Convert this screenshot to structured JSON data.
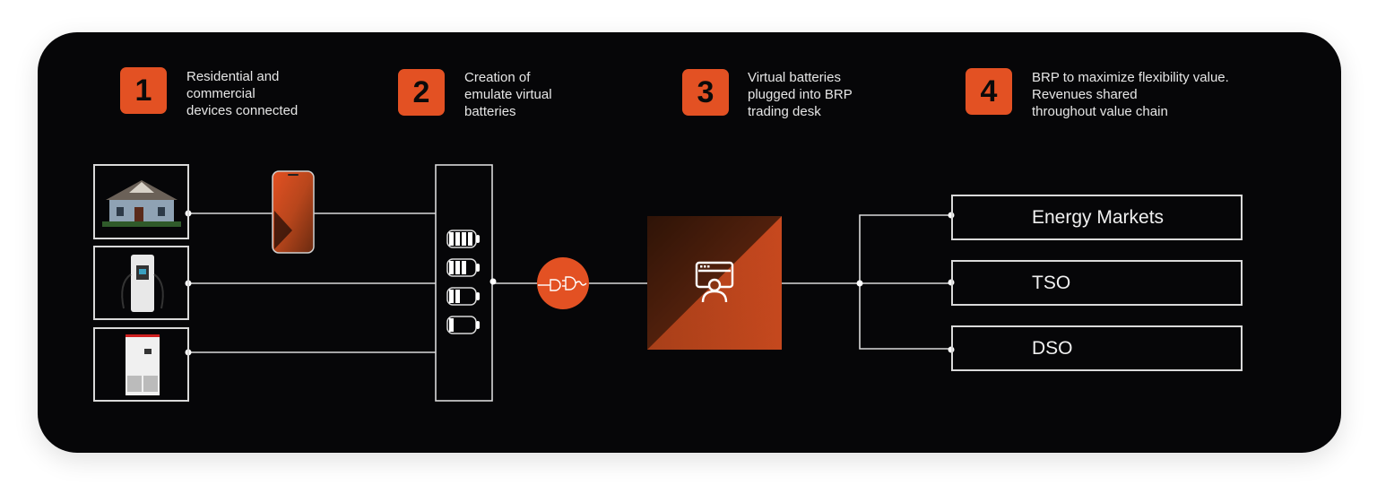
{
  "steps": [
    {
      "number": "1",
      "text": "Residential and\ncommercial\ndevices connected"
    },
    {
      "number": "2",
      "text": "Creation of\nemulate virtual\nbatteries"
    },
    {
      "number": "3",
      "text": "Virtual batteries\nplugged into BRP\ntrading desk"
    },
    {
      "number": "4",
      "text": "BRP to maximize flexibility value.\nRevenues shared\nthroughout value chain"
    }
  ],
  "devices": [
    {
      "name": "house",
      "icon": "house-icon"
    },
    {
      "name": "ev-charger",
      "icon": "ev-charger-icon"
    },
    {
      "name": "battery-cabinet",
      "icon": "battery-cabinet-icon"
    }
  ],
  "phone": {
    "icon": "smartphone-icon"
  },
  "virtual_batteries": {
    "levels": [
      1.0,
      0.75,
      0.5,
      0.25
    ]
  },
  "plug": {
    "icon": "plug-connector-icon"
  },
  "trading_desk": {
    "icon": "trader-monitor-icon"
  },
  "targets": [
    {
      "label": "Energy Markets"
    },
    {
      "label": "TSO"
    },
    {
      "label": "DSO"
    }
  ],
  "colors": {
    "accent": "#e35123",
    "background": "#060608",
    "line": "#d9d9d9"
  }
}
